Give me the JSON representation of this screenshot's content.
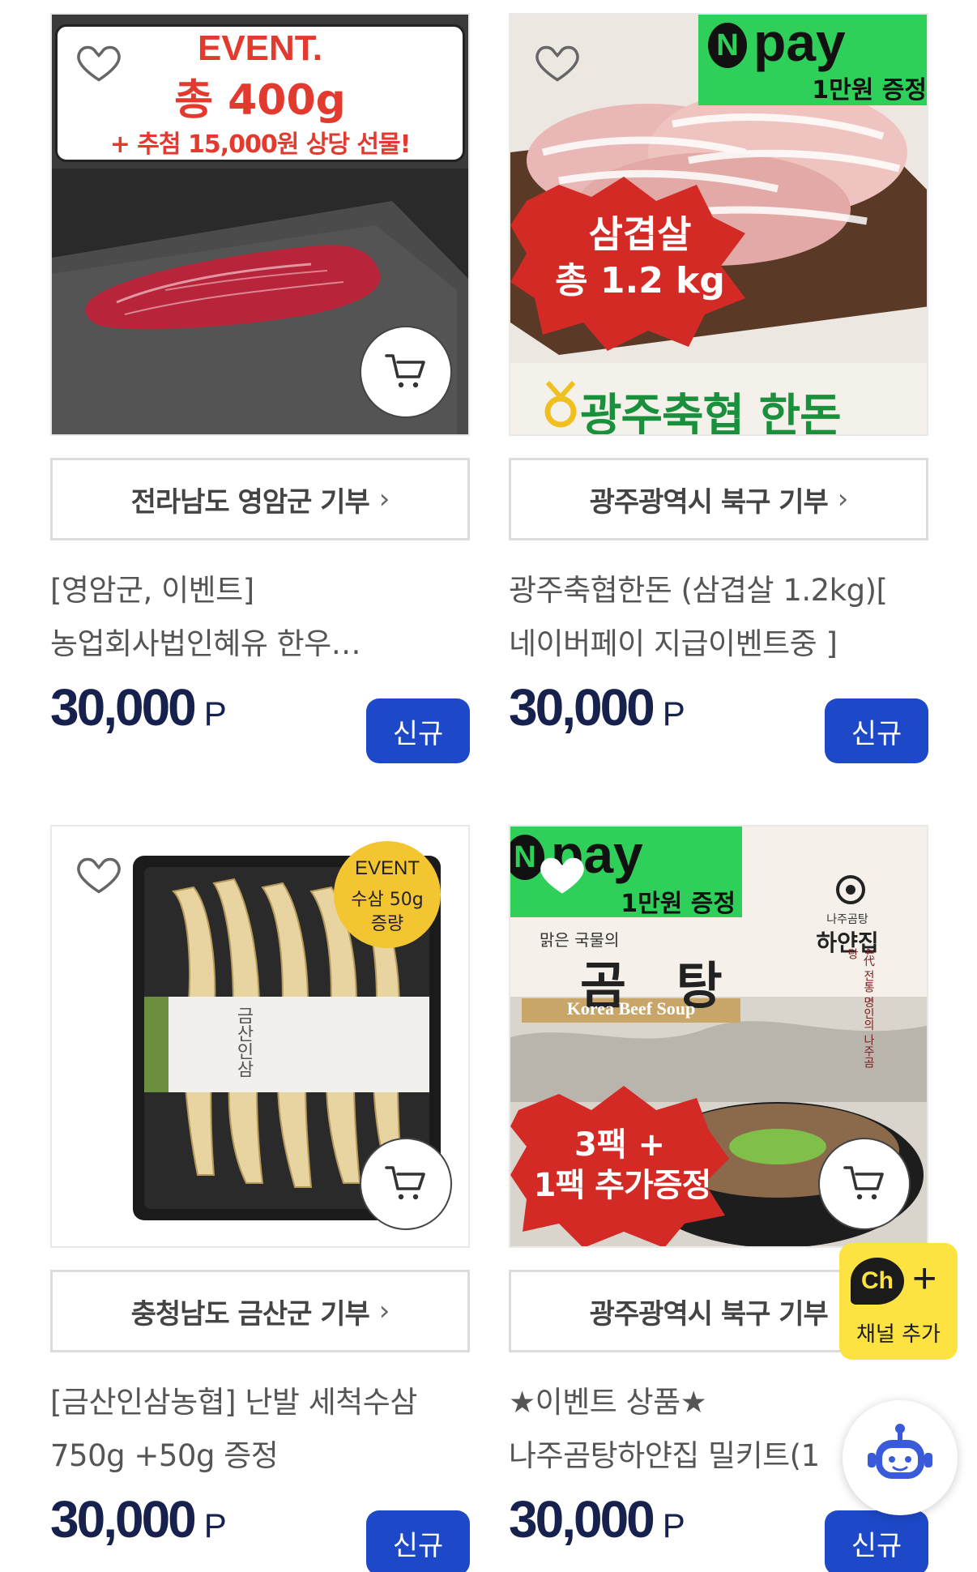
{
  "products": [
    {
      "donation": "전라남도 영암군 기부",
      "title_lines": [
        "[영암군, 이벤트]",
        "농업회사법인혜유 한우…"
      ],
      "price": "30,000",
      "unit": "P",
      "badge": "신규",
      "image_text": {
        "event": "EVENT.",
        "weight": "총 400g",
        "gift": "+ 추첨 15,000원 상당 선물!"
      }
    },
    {
      "donation": "광주광역시 북구 기부",
      "title_lines": [
        "광주축협한돈 (삼겹살 1.2kg)[",
        "네이버페이 지급이벤트중 ]"
      ],
      "price": "30,000",
      "unit": "P",
      "badge": "신규",
      "image_text": {
        "npay": "pay",
        "npay_sub": "1만원 증정",
        "cut": "삼겹살",
        "weight": "총 1.2 kg",
        "brand": "광주축협 한돈"
      }
    },
    {
      "donation": "충청남도 금산군 기부",
      "title_lines": [
        "[금산인삼농협] 난발 세척수삼",
        "750g +50g 증정"
      ],
      "price": "30,000",
      "unit": "P",
      "badge": "신규",
      "image_text": {
        "event": "EVENT",
        "line1": "수삼 50g",
        "line2": "증량",
        "label": "금산인삼"
      }
    },
    {
      "donation": "광주광역시 북구 기부",
      "title_lines": [
        "★이벤트 상품★",
        "나주곰탕하얀집 밀키트(1"
      ],
      "price": "30,000",
      "unit": "P",
      "badge": "신규",
      "image_text": {
        "npay": "pay",
        "npay_sub": "1만원 증정",
        "brand": "하얀집",
        "brand_small": "나주곰탕",
        "clear_soup": "맑은 국물의",
        "gomtang": "곰 탕",
        "english": "Korea Beef Soup",
        "vertical": "4代 전통 명인의 나주곰탕",
        "promo1": "3팩 +",
        "promo2": "1팩 추가증정"
      }
    }
  ],
  "channel_button": {
    "logo": "Ch",
    "plus": "+",
    "label": "채널 추가"
  },
  "colors": {
    "accent": "#1d49c8",
    "price": "#16224d",
    "npay_green": "#2ed05a",
    "event_red": "#e53935",
    "kakao_yellow": "#fce342"
  },
  "icons": [
    "heart-icon",
    "cart-icon",
    "chevron-right-icon",
    "chatbot-icon"
  ]
}
